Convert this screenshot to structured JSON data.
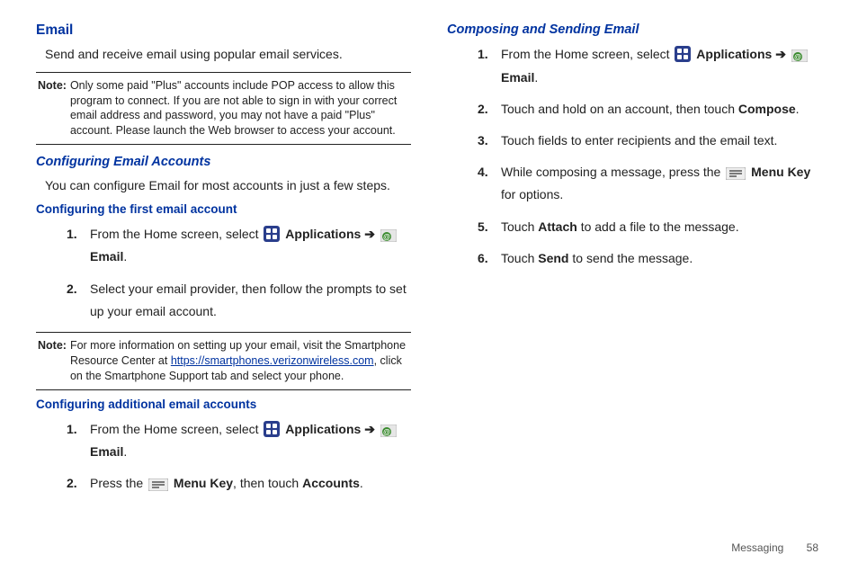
{
  "leftCol": {
    "title": "Email",
    "intro": "Send and receive email using popular email services.",
    "note1Label": "Note:",
    "note1": "Only some paid \"Plus\" accounts include POP access to allow this program to connect. If you are not able to sign in with your correct email address and password, you may not have a paid \"Plus\" account. Please launch the Web browser to access your account.",
    "h2a": "Configuring Email Accounts",
    "h2a_body": "You can configure Email for most accounts in just a few steps.",
    "h3a": "Configuring the first email account",
    "s1": {
      "n1": "1.",
      "t1a": "From the Home screen, select ",
      "apps": "Applications",
      "arrow": " ➔ ",
      "email": "Email",
      "t1end": ".",
      "n2": "2.",
      "t2": "Select your email provider, then follow the prompts to set up your email account."
    },
    "note2Label": "Note:",
    "note2a": "For more information on setting up your email, visit the Smartphone Resource Center at ",
    "note2link": "https://smartphones.verizonwireless.com",
    "note2b": ", click on the Smartphone Support tab and select your phone.",
    "h3b": "Configuring additional email accounts",
    "s2": {
      "n1": "1.",
      "t1a": "From the Home screen, select ",
      "apps": "Applications",
      "arrow": " ➔ ",
      "email": "Email",
      "t1end": ".",
      "n2": "2.",
      "t2a": "Press the ",
      "menu": "Menu Key",
      "t2b": ", then touch ",
      "accts": "Accounts",
      "t2end": "."
    }
  },
  "rightCol": {
    "h2": "Composing and Sending Email",
    "s": {
      "n1": "1.",
      "t1a": "From the Home screen, select ",
      "apps": "Applications",
      "arrow": " ➔ ",
      "email": "Email",
      "t1end": ".",
      "n2": "2.",
      "t2a": "Touch and hold on an account, then touch ",
      "compose": "Compose",
      "t2end": ".",
      "n3": "3.",
      "t3": "Touch fields to enter recipients and the email text.",
      "n4": "4.",
      "t4a": "While composing a message, press the ",
      "menu": "Menu Key",
      "t4b": " for options.",
      "n5": "5.",
      "t5a": "Touch ",
      "attach": "Attach",
      "t5b": " to add a file to the message.",
      "n6": "6.",
      "t6a": "Touch ",
      "send": "Send",
      "t6b": " to send the message."
    }
  },
  "footer": {
    "section": "Messaging",
    "page": "58"
  }
}
